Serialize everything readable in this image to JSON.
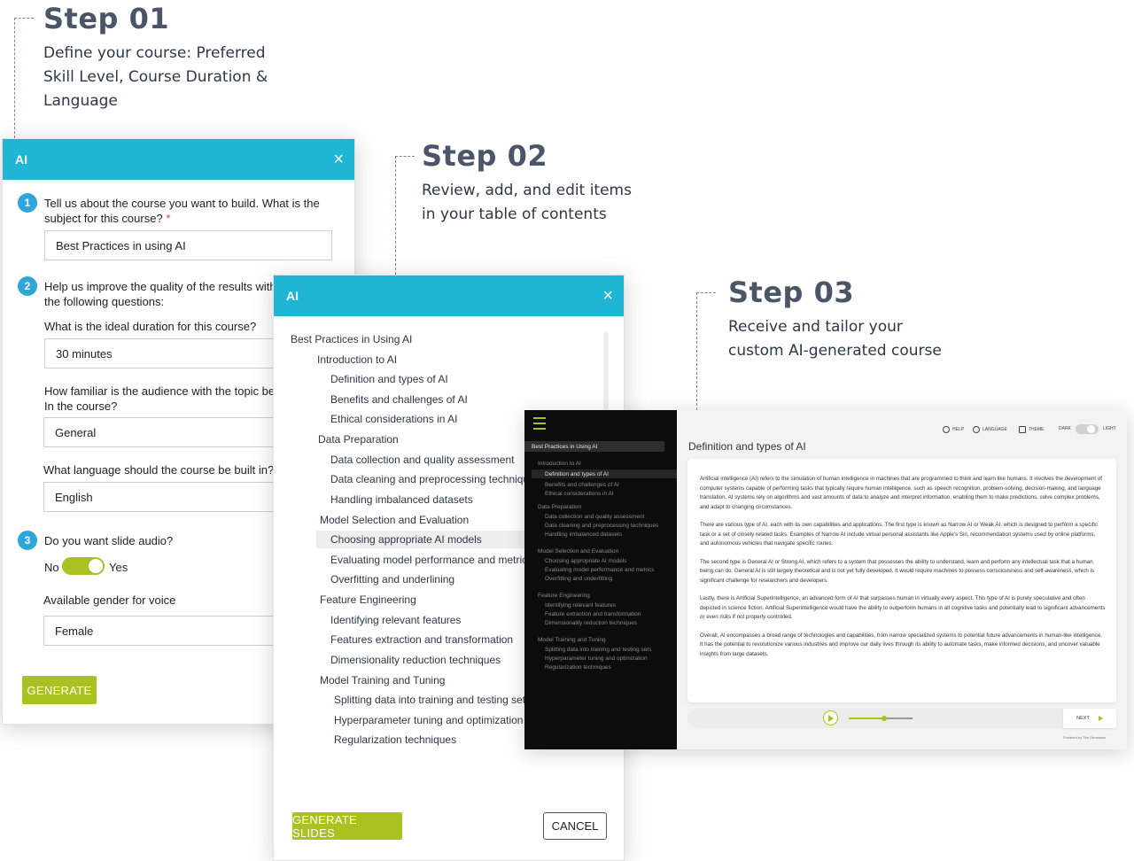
{
  "steps": [
    {
      "title": "Step 01",
      "desc_lines": [
        "Define your course: Preferred",
        "Skill Level, Course Duration &",
        "Language"
      ]
    },
    {
      "title": "Step 02",
      "desc_lines": [
        "Review, add, and edit items",
        "in your table of contents"
      ]
    },
    {
      "title": "Step 03",
      "desc_lines": [
        "Receive and tailor your",
        "custom AI-generated course"
      ]
    }
  ],
  "dialog1": {
    "title": "AI",
    "close": "×",
    "q1": {
      "num": "1",
      "text_lines": [
        "Tell us about the course you want to build. What is the",
        "subject for this course?"
      ],
      "required": "*",
      "value": "Best Practices in using AI"
    },
    "q2": {
      "num": "2",
      "text_lines": [
        "Help us improve the quality of the results with",
        "the following questions:"
      ],
      "duration_label": "What is the ideal duration for this course?",
      "duration_value": "30 minutes",
      "familiar_label_lines": [
        "How familiar is the audience with the topic be",
        "In the course?"
      ],
      "familiar_value": "General",
      "language_label": "What language should the course be built in?",
      "language_value": "English"
    },
    "q3": {
      "num": "3",
      "text": "Do you want slide audio?",
      "no": "No",
      "yes": "Yes",
      "gender_label": "Available gender for voice",
      "gender_value": "Female"
    },
    "generate": "GENERATE"
  },
  "dialog2": {
    "title": "AI",
    "close": "×",
    "toc": [
      "Best Practices in Using AI",
      "Introduction to AI",
      "Definition and types of AI",
      "Benefits and challenges of AI",
      "Ethical considerations in AI",
      "Data Preparation",
      "Data collection and quality assessment",
      "Data cleaning and preprocessing technique",
      "Handling imbalanced datasets",
      "Model Selection and Evaluation",
      "Choosing appropriate AI models",
      "Evaluating model performance and metrics",
      "Overfitting and underlining",
      "Feature Engineering",
      "Identifying relevant features",
      "Features extraction and transformation",
      "Dimensionality reduction techniques",
      "Model Training and Tuning",
      "Splitting data into training and testing sets",
      "Hyperparameter tuning and optimization",
      "Regularization techniques"
    ],
    "generate_slides": "GENERATE SLIDES",
    "cancel": "CANCEL"
  },
  "player": {
    "sidebar": [
      "Best Practices in Using AI",
      "Introduction to AI",
      "Definition and types of AI",
      "Benefits and challenges of AI",
      "Ethical considerations in AI",
      "Data Preparation",
      "Data collection and quality assessment",
      "Data cleaning and preprocessing techniques",
      "Handling imbalanced datasets",
      "Model Selection and Evaluation",
      "Choosing appropriate AI models",
      "Evaluating model performance and metrics",
      "Overfitting and underfitting",
      "Feature Engineering",
      "Identifying relevant features",
      "Feature extraction and transformation",
      "Dimensionality reduction techniques",
      "Model Training and Tuning",
      "Splitting data into training and testing sets",
      "Hyperparameter tuning and optimization",
      "Regularization techniques"
    ],
    "topbar": {
      "help": "HELP",
      "language": "LANGUAGE",
      "theme": "THEME",
      "dark": "DARK",
      "light": "LIGHT"
    },
    "slide_title": "Definition and types of AI",
    "paragraphs": [
      "Artificial intelligence (AI) refers to the simulation of human intelligence in machines that are programmed to think and learn like humans. It involves the development of computer systems capable of performing tasks that typically require human intelligence, such as speech recognition, problem-solving, decision-making, and language translation. AI systems rely on algorithms and vast amounts of data to analyze and interpret information, enabling them to make predictions, solve complex problems, and adapt to changing circumstances.",
      "There are various type of AI, each with its own capabilities and applications. The first type is known as Narrow AI or Weak AI, which is designed to perform a specific task or a set of closely related tasks. Examples of Narrow AI include virtual personal assistants like Apple's Siri, recommendation systems used by online platforms, and autonomous vehicles that navigate specific routes.",
      "The second type is General AI or Strong AI, which refers to a system that possesses the ability to understand, learn and perform any intellectual task that a human being can do. General AI is still largely theoretical and is not yet fully developed. It would require machines to possess consciousness and self-awareness, which is significant challenge for researchers and developers.",
      "Lastly, there is Artificial Superintelligence, an advanced form of AI that surpasses human in virtually every aspect. This type of AI is purely speculative and often depicted in science fiction. Artificial Superintelligence would have the ability to outperform humans in all cognitive tasks and potentially lead to significant advancements or even risks if not properly controlled.",
      "Overall, AI encompasses a broad range of technologies and capabilities, from narrow specialized systems to potential future advancements in human-like intelligence. It has the potential to revolutionize various industries and improve our daily lives through its ability to automate tasks, make informed decisions, and uncover valuable insights from large datasets."
    ],
    "audio_progress": 0.55,
    "next": "NEXT",
    "powered": "Powered by The Generator"
  },
  "colors": {
    "accent": "#1fb6d6",
    "green": "#a9c21f",
    "step_title": "#4a5568"
  }
}
